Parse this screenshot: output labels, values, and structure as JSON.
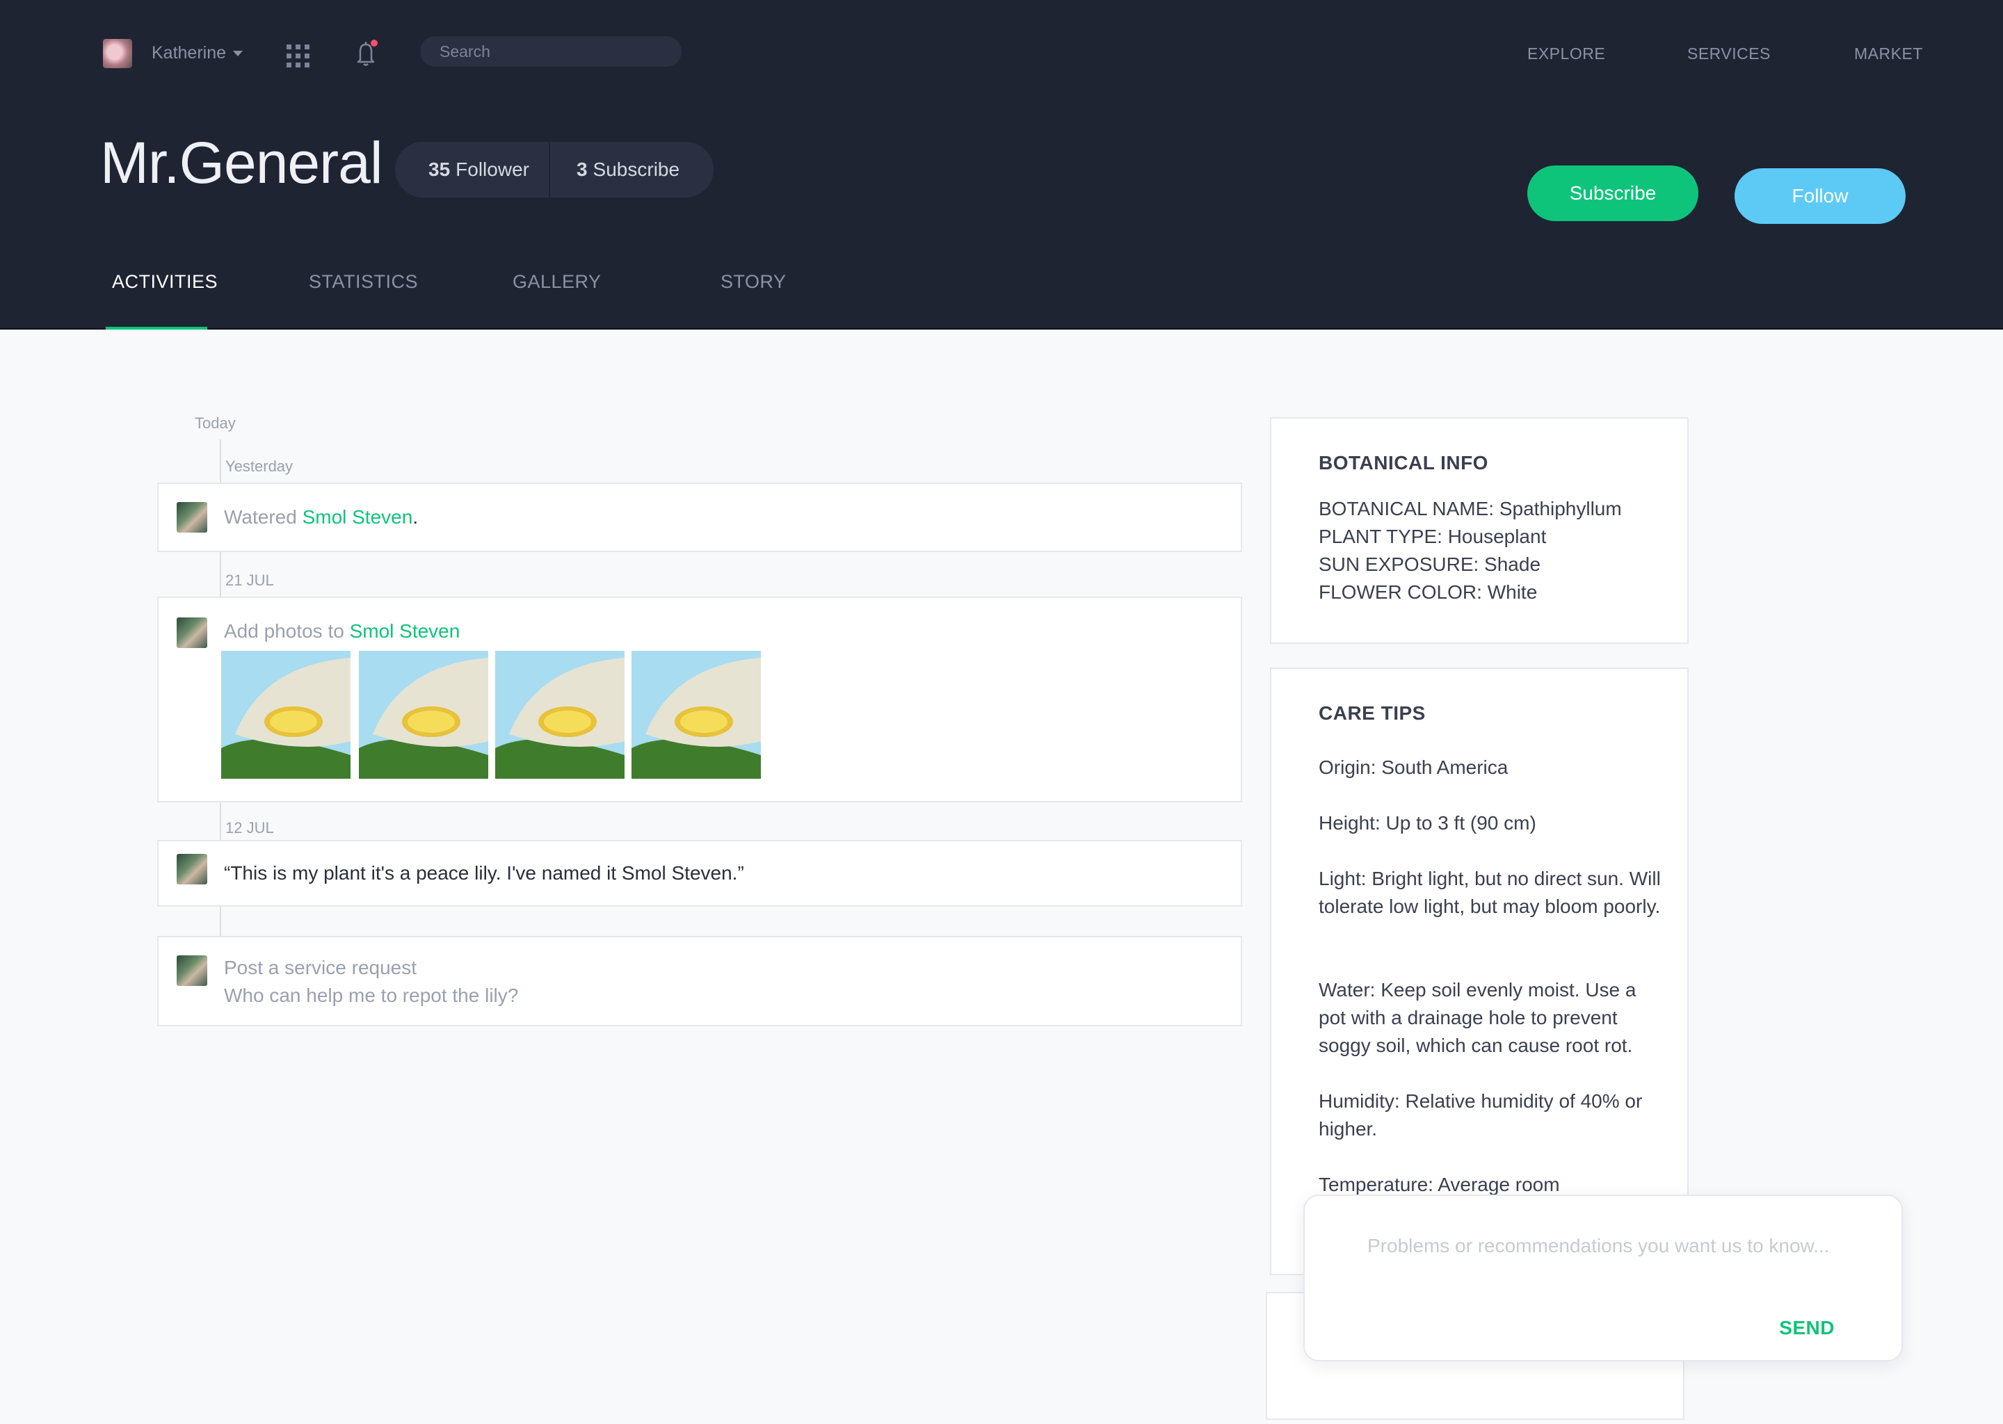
{
  "topbar": {
    "user_name": "Katherine",
    "search_placeholder": "Search",
    "nav": [
      "EXPLORE",
      "SERVICES",
      "MARKET"
    ]
  },
  "profile": {
    "name": "Mr.General",
    "followers_count": "35",
    "followers_label": "Follower",
    "subscribe_count": "3",
    "subscribe_label": "Subscribe",
    "subscribe_button": "Subscribe",
    "follow_button": "Follow"
  },
  "tabs": [
    "ACTIVITIES",
    "STATISTICS",
    "GALLERY",
    "STORY"
  ],
  "timeline": {
    "today": "Today",
    "groups": [
      {
        "date": "Yesterday",
        "prefix": "Watered ",
        "link": "Smol Steven",
        "suffix": "."
      },
      {
        "date": "21 JUL",
        "prefix": "Add photos to ",
        "link": "Smol Steven",
        "photo_count": 4
      },
      {
        "date": "12 JUL",
        "quote": "“This is my plant it's a peace lily. I've named it Smol Steven.”"
      },
      {
        "title": "Post a service request",
        "body": "Who can help me to repot the lily?"
      }
    ]
  },
  "botanical": {
    "title": "BOTANICAL INFO",
    "lines": [
      "BOTANICAL NAME: Spathiphyllum",
      "PLANT TYPE:  Houseplant",
      "SUN EXPOSURE:  Shade",
      "FLOWER COLOR:  White"
    ]
  },
  "care": {
    "title": "CARE TIPS",
    "tips": [
      "Origin: South America",
      "Height: Up to 3 ft (90 cm)",
      "Light: Bright light, but no direct sun. Will tolerate low light, but may bloom poorly.",
      "Water: Keep soil evenly moist. Use a pot with a drainage hole to prevent soggy soil, which can cause root rot.",
      "Humidity: Relative humidity of 40% or higher.",
      "Temperature: Average room"
    ]
  },
  "feedback": {
    "placeholder": "Problems or recommendations you want us to know...",
    "send": "SEND"
  },
  "colors": {
    "header_bg": "#1f2433",
    "accent_green": "#0ec47a",
    "follow_blue": "#5ccaf5",
    "notification_dot": "#ff4d6d"
  }
}
